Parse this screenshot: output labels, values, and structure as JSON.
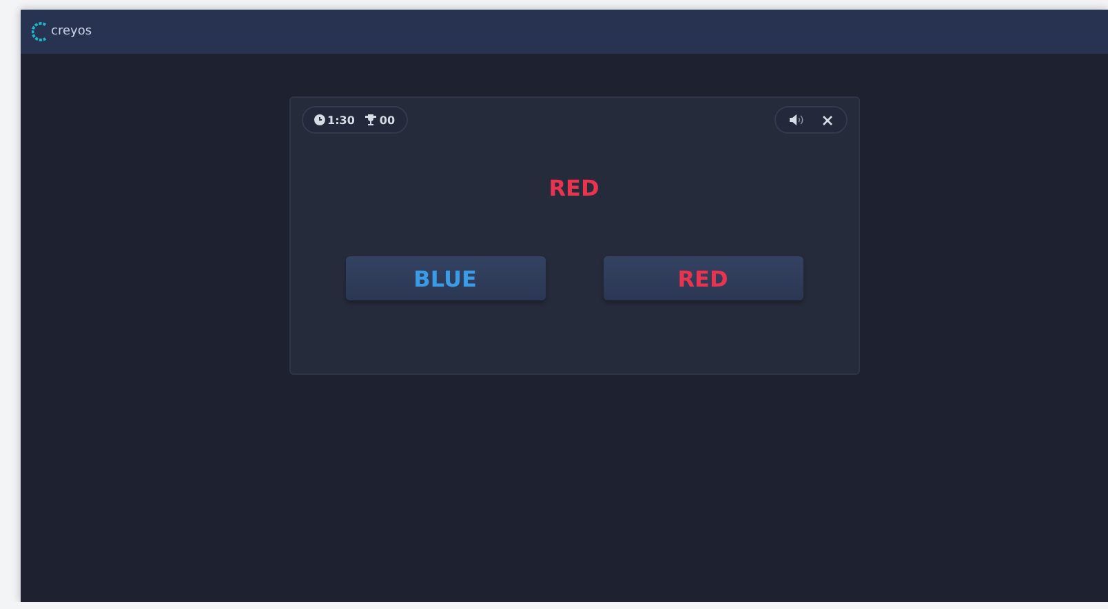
{
  "header": {
    "logo": "creyos"
  },
  "game": {
    "timer": "1:30",
    "score": "00",
    "prompt": {
      "text": "RED",
      "color": "#e8344e"
    },
    "answers": [
      {
        "label": "BLUE",
        "color": "#3a9be6"
      },
      {
        "label": "RED",
        "color": "#e8344e"
      }
    ]
  }
}
